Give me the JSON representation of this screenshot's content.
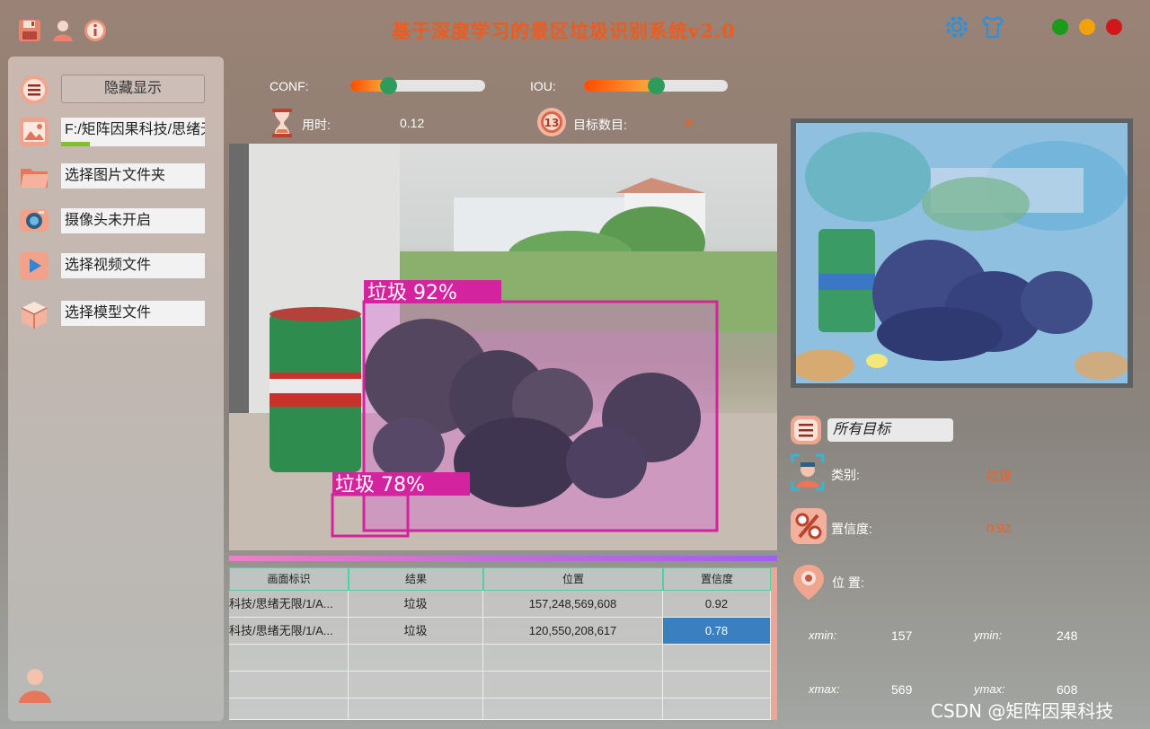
{
  "app": {
    "title": "基于深度学习的景区垃圾识别系统v2.0"
  },
  "colors": {
    "accent_orange": "#f05a1c",
    "window_close": "#d0181a",
    "window_minimize": "#f4a20b",
    "window_maximize": "#1a9b1a",
    "box_magenta": "#d4239f",
    "selected_cell": "#3a7fbf"
  },
  "titlebar_icons": [
    "save-icon",
    "user-icon",
    "info-icon",
    "settings-gear-icon",
    "tshirt-skin-icon"
  ],
  "sidebar": {
    "toggle_label": "隐藏显示",
    "image_path": "F:/矩阵因果科技/思绪无",
    "image_load_progress": 0.2,
    "folder_label": "选择图片文件夹",
    "camera_label": "摄像头未开启",
    "video_label": "选择视频文件",
    "model_label": "选择模型文件"
  },
  "controls": {
    "conf_label": "CONF:",
    "conf_value": 0.25,
    "iou_label": "IOU:",
    "iou_value": 0.5,
    "time_label": "用时:",
    "time_value": "0.12",
    "count_label": "目标数目:",
    "count_value": "8"
  },
  "detections": [
    {
      "label": "垃圾 92%"
    },
    {
      "label": "垃圾 78%"
    }
  ],
  "table": {
    "headers": [
      "画面标识",
      "结果",
      "位置",
      "置信度"
    ],
    "rows": [
      [
        "科技/思绪无限/1/A...",
        "垃圾",
        "157,248,569,608",
        "0.92"
      ],
      [
        "科技/思绪无限/1/A...",
        "垃圾",
        "120,550,208,617",
        "0.78"
      ]
    ]
  },
  "panel": {
    "target_select": "所有目标",
    "class_label": "类别:",
    "class_value": "垃圾",
    "conf_label": "置信度:",
    "conf_value": "0.92",
    "pos_label": "位 置:",
    "xmin_label": "xmin:",
    "xmin_value": "157",
    "ymin_label": "ymin:",
    "ymin_value": "248",
    "xmax_label": "xmax:",
    "xmax_value": "569",
    "ymax_label": "ymax:",
    "ymax_value": "608"
  },
  "watermark": "CSDN @矩阵因果科技"
}
